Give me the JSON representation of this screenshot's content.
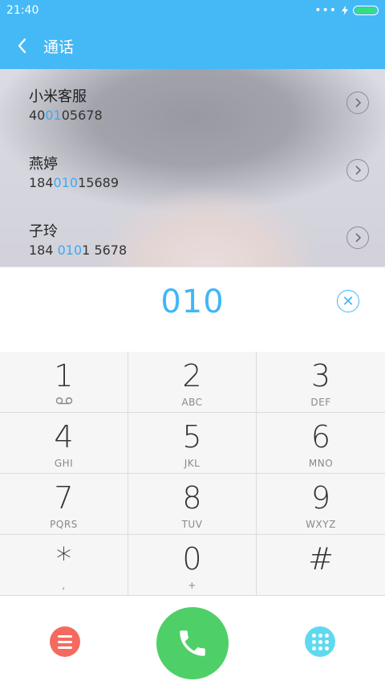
{
  "status_bar": {
    "time": "21:40",
    "dots": "•••"
  },
  "header": {
    "title": "通话"
  },
  "contacts": [
    {
      "name": "小米客服",
      "number_parts": [
        {
          "text": "40",
          "match": false
        },
        {
          "text": "01",
          "match": true
        },
        {
          "text": "05678",
          "match": false
        }
      ]
    },
    {
      "name": "燕婷",
      "number_parts": [
        {
          "text": "184",
          "match": false
        },
        {
          "text": "010",
          "match": true
        },
        {
          "text": "15689",
          "match": false
        }
      ]
    },
    {
      "name": "子玲",
      "number_parts": [
        {
          "text": "184 ",
          "match": false
        },
        {
          "text": "010",
          "match": true
        },
        {
          "text": "1 5678",
          "match": false
        }
      ]
    }
  ],
  "dialer": {
    "number": "010"
  },
  "keypad": [
    {
      "digit": "1",
      "letters": "",
      "voicemail": true
    },
    {
      "digit": "2",
      "letters": "ABC"
    },
    {
      "digit": "3",
      "letters": "DEF"
    },
    {
      "digit": "4",
      "letters": "GHI"
    },
    {
      "digit": "5",
      "letters": "JKL"
    },
    {
      "digit": "6",
      "letters": "MNO"
    },
    {
      "digit": "7",
      "letters": "PQRS"
    },
    {
      "digit": "8",
      "letters": "TUV"
    },
    {
      "digit": "9",
      "letters": "WXYZ"
    },
    {
      "digit": "*",
      "letters": ","
    },
    {
      "digit": "0",
      "letters": "+"
    },
    {
      "digit": "#",
      "letters": ""
    }
  ],
  "colors": {
    "accent": "#45b9f6",
    "match_highlight": "#3fa9f5",
    "call_button": "#4fcf68",
    "menu_button": "#f56a5f",
    "keypad_toggle": "#5fd9f0"
  },
  "icons": {
    "back": "chevron-left-icon",
    "detail": "chevron-right-circle-icon",
    "clear": "close-circle-icon",
    "menu": "menu-icon",
    "call": "phone-icon",
    "keypad": "dialpad-icon",
    "charging": "lightning-icon",
    "battery": "battery-icon",
    "voicemail": "voicemail-icon"
  }
}
